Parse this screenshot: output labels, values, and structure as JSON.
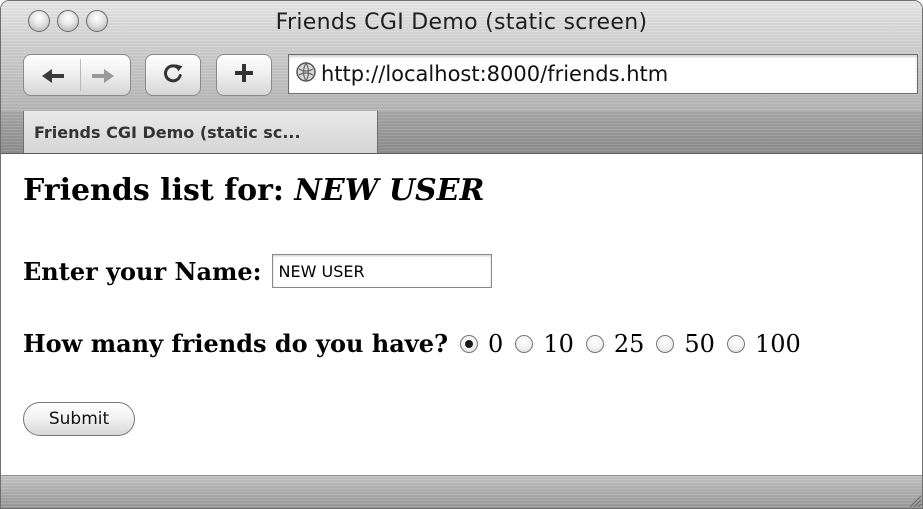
{
  "window": {
    "title": "Friends CGI Demo (static screen)"
  },
  "toolbar": {
    "back_icon": "back-arrow-icon",
    "forward_icon": "forward-arrow-icon",
    "reload_icon": "reload-icon",
    "add_icon": "add-bookmark-icon",
    "url": "http://localhost:8000/friends.htm"
  },
  "tabs": [
    {
      "label": "Friends CGI Demo (static sc..."
    }
  ],
  "page": {
    "heading_prefix": "Friends list for:",
    "heading_name": "NEW USER",
    "name_label": "Enter your Name:",
    "name_value": "NEW USER",
    "friends_question": "How many friends do you have?",
    "friend_options": [
      "0",
      "10",
      "25",
      "50",
      "100"
    ],
    "selected_option": "0",
    "submit_label": "Submit"
  }
}
